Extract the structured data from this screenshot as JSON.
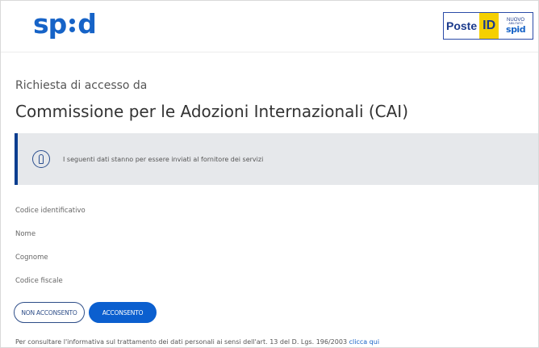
{
  "header": {
    "spid_logo": "spid",
    "poste": {
      "poste_label": "Poste",
      "id_label": "ID",
      "nuovo_label": "NUOVO",
      "abilitato_label": "ABILITATO",
      "spid_label": "spid"
    }
  },
  "main": {
    "subtitle": "Richiesta di accesso da",
    "title": "Commissione per le Adozioni Internazionali (CAI)",
    "notice": "I seguenti dati stanno per essere inviati al fornitore dei servizi",
    "fields": [
      "Codice identificativo",
      "Nome",
      "Cognome",
      "Codice fiscale"
    ],
    "buttons": {
      "deny_label": "NON ACCONSENTO",
      "accept_label": "ACCONSENTO"
    },
    "footer": {
      "text": "Per consultare l'informativa sul trattamento dei dati personali ai sensi dell'art. 13 del D. Lgs. 196/2003",
      "link": "clicca qui"
    }
  },
  "colors": {
    "spid_blue": "#1663c7",
    "notice_bg": "#e6e8eb",
    "notice_border": "#0a3d8f",
    "accept_button": "#0b5fcf",
    "poste_yellow": "#f5d000"
  },
  "icons": [
    "info-icon"
  ]
}
